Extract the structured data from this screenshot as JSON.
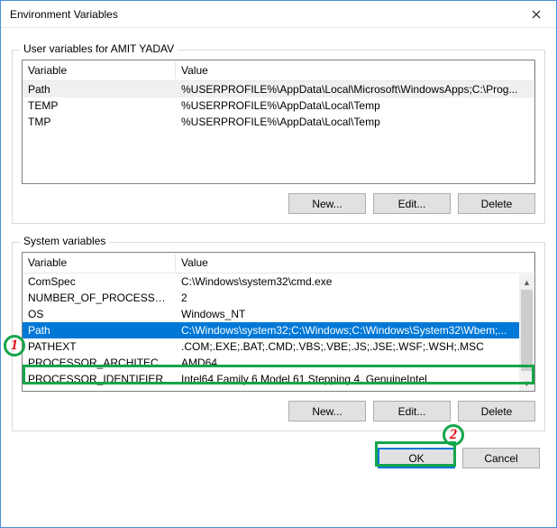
{
  "window": {
    "title": "Environment Variables"
  },
  "user_section": {
    "label": "User variables for AMIT YADAV",
    "headers": {
      "variable": "Variable",
      "value": "Value"
    },
    "rows": [
      {
        "variable": "Path",
        "value": "%USERPROFILE%\\AppData\\Local\\Microsoft\\WindowsApps;C:\\Prog..."
      },
      {
        "variable": "TEMP",
        "value": "%USERPROFILE%\\AppData\\Local\\Temp"
      },
      {
        "variable": "TMP",
        "value": "%USERPROFILE%\\AppData\\Local\\Temp"
      }
    ],
    "buttons": {
      "new": "New...",
      "edit": "Edit...",
      "delete": "Delete"
    }
  },
  "system_section": {
    "label": "System variables",
    "headers": {
      "variable": "Variable",
      "value": "Value"
    },
    "rows": [
      {
        "variable": "ComSpec",
        "value": "C:\\Windows\\system32\\cmd.exe"
      },
      {
        "variable": "NUMBER_OF_PROCESSORS",
        "value": "2"
      },
      {
        "variable": "OS",
        "value": "Windows_NT"
      },
      {
        "variable": "Path",
        "value": "C:\\Windows\\system32;C:\\Windows;C:\\Windows\\System32\\Wbem;..."
      },
      {
        "variable": "PATHEXT",
        "value": ".COM;.EXE;.BAT;.CMD;.VBS;.VBE;.JS;.JSE;.WSF;.WSH;.MSC"
      },
      {
        "variable": "PROCESSOR_ARCHITECTURE",
        "value": "AMD64"
      },
      {
        "variable": "PROCESSOR_IDENTIFIER",
        "value": "Intel64 Family 6 Model 61 Stepping 4, GenuineIntel"
      }
    ],
    "buttons": {
      "new": "New...",
      "edit": "Edit...",
      "delete": "Delete"
    }
  },
  "dialog_buttons": {
    "ok": "OK",
    "cancel": "Cancel"
  },
  "annotations": {
    "one": "1",
    "two": "2"
  }
}
